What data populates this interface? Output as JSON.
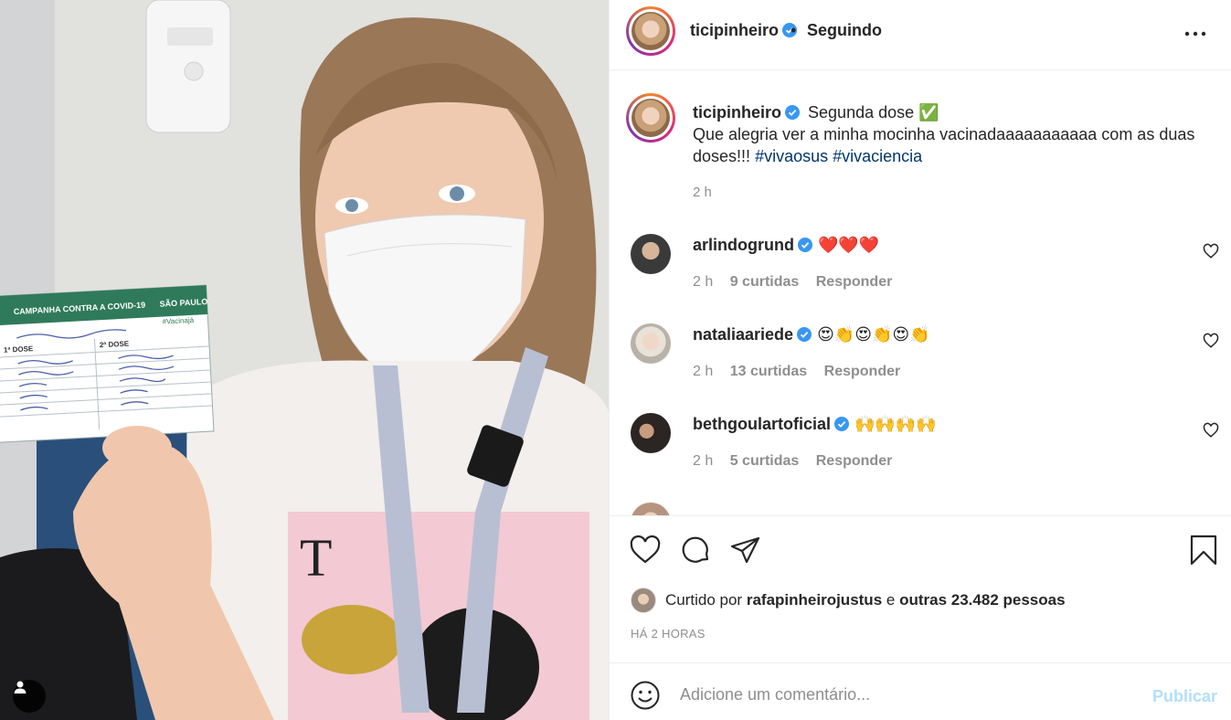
{
  "post": {
    "username": "ticipinheiro",
    "follow_status": "Seguindo",
    "caption_title": "Segunda dose ✅",
    "caption_body": "Que alegria ver a minha mocinha vacinadaaaaaaaaaaa com as duas doses!!!",
    "hashtags": [
      "#vivaosus",
      "#vivaciencia"
    ],
    "caption_time": "2 h"
  },
  "photo": {
    "card_title": "CAMPANHA CONTRA A COVID-19",
    "card_brand": "SÃO PAULO",
    "card_hashtag": "#Vacinajá",
    "card_col1": "1ª DOSE",
    "card_col2": "2ª DOSE",
    "shirt_letter": "T"
  },
  "comments": [
    {
      "username": "arlindogrund",
      "text": "❤️❤️❤️",
      "time": "2 h",
      "likes": "9 curtidas",
      "reply": "Responder"
    },
    {
      "username": "nataliaariede",
      "text": "😍👏😍👏😍👏",
      "time": "2 h",
      "likes": "13 curtidas",
      "reply": "Responder"
    },
    {
      "username": "bethgoulartoficial",
      "text": "🙌🙌🙌🙌",
      "time": "2 h",
      "likes": "5 curtidas",
      "reply": "Responder"
    }
  ],
  "likes": {
    "prefix": "Curtido por",
    "user": "rafapinheirojustus",
    "connector": "e",
    "others": "outras 23.482 pessoas"
  },
  "time_ago": "HÁ 2 HORAS",
  "composer": {
    "placeholder": "Adicione um comentário...",
    "publish": "Publicar"
  },
  "colors": {
    "link": "#00376b",
    "muted": "#8e8e8e",
    "verified": "#3897f0",
    "publish_disabled": "#b2dffc"
  }
}
